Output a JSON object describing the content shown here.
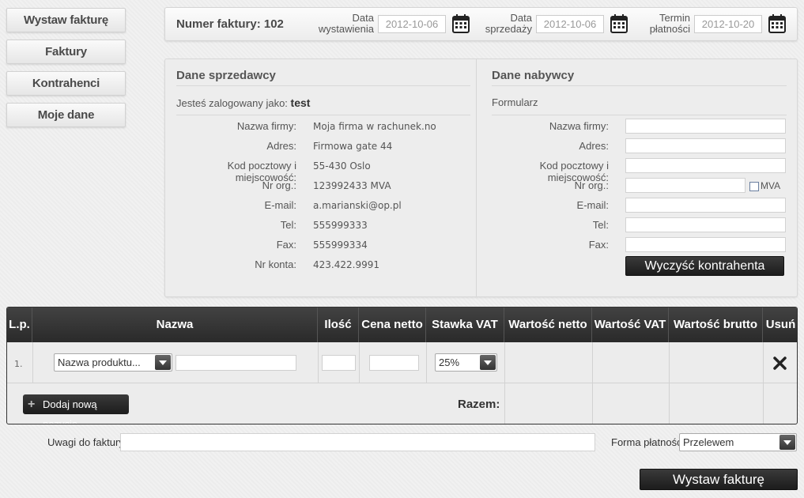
{
  "nav": {
    "items": [
      {
        "label": "Wystaw fakturę"
      },
      {
        "label": "Faktury"
      },
      {
        "label": "Kontrahenci"
      },
      {
        "label": "Moje dane"
      }
    ]
  },
  "header": {
    "invoice_number_label": "Numer faktury: 102",
    "issue_date": {
      "label_line1": "Data",
      "label_line2": "wystawienia",
      "value": "2012-10-06"
    },
    "sale_date": {
      "label_line1": "Data",
      "label_line2": "sprzedaży",
      "value": "2012-10-06"
    },
    "due_date": {
      "label_line1": "Termin",
      "label_line2": "płatności",
      "value": "2012-10-20"
    },
    "calendar_icon": "calendar-icon"
  },
  "seller": {
    "title": "Dane sprzedawcy",
    "logged_in_label": "Jesteś zalogowany jako:",
    "logged_in_user": "test",
    "fields": [
      {
        "label": "Nazwa firmy:",
        "value": "Moja firma w rachunek.no"
      },
      {
        "label": "Adres:",
        "value": "Firmowa gate 44"
      },
      {
        "label": "Kod pocztowy i miejscowość:",
        "value": "55-430 Oslo"
      },
      {
        "label": "Nr org.:",
        "value": "123992433 MVA"
      },
      {
        "label": "E-mail:",
        "value": "a.marianski@op.pl"
      },
      {
        "label": "Tel:",
        "value": "555999333"
      },
      {
        "label": "Fax:",
        "value": "555999334"
      },
      {
        "label": "Nr konta:",
        "value": "423.422.9991"
      }
    ]
  },
  "buyer": {
    "title": "Dane nabywcy",
    "form_label": "Formularz",
    "fields": [
      {
        "label": "Nazwa firmy:"
      },
      {
        "label": "Adres:"
      },
      {
        "label": "Kod pocztowy i miejscowość:"
      },
      {
        "label": "Nr org.:"
      },
      {
        "label": "E-mail:"
      },
      {
        "label": "Tel:"
      },
      {
        "label": "Fax:"
      }
    ],
    "mva_label": "MVA",
    "clear_button": "Wyczyść kontrahenta"
  },
  "table": {
    "headers": [
      "L.p.",
      "Nazwa",
      "Ilość",
      "Cena netto",
      "Stawka VAT",
      "Wartość netto",
      "Wartość VAT",
      "Wartość brutto",
      "Usuń"
    ],
    "rows": [
      {
        "lp": "1.",
        "product_select": "Nazwa produktu...",
        "vat": "25%"
      }
    ],
    "delete_icon": "close-icon",
    "add_button": "Dodaj nową pozycję",
    "total_label": "Razem:"
  },
  "footer": {
    "notes_label": "Uwagi do faktury:",
    "payment_label": "Forma płatności:",
    "payment_value": "Przelewem",
    "submit_button": "Wystaw fakturę"
  }
}
